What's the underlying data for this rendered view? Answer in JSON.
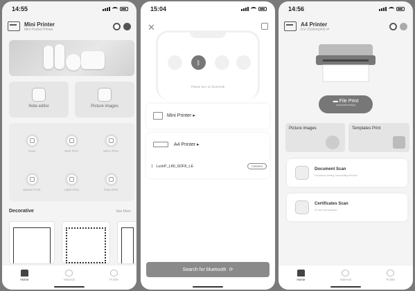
{
  "screen1": {
    "time": "14:55",
    "header": {
      "title": "Mini Printer",
      "subtitle": "Mini Pocket Printer"
    },
    "cards": [
      {
        "label": "Note editor",
        "icon": "note-editor-icon"
      },
      {
        "label": "Picture images",
        "icon": "picture-icon"
      }
    ],
    "grid": [
      {
        "label": "Scan",
        "icon": "scan-icon"
      },
      {
        "label": "Web Print",
        "icon": "web-print-icon"
      },
      {
        "label": "Micro Print",
        "icon": "micro-print-icon"
      },
      {
        "label": "Banner Print",
        "icon": "banner-print-icon"
      },
      {
        "label": "Label Print",
        "icon": "label-print-icon"
      },
      {
        "label": "Todo Print",
        "icon": "todo-print-icon"
      }
    ],
    "section_title": "Decorative",
    "see_more": "See More",
    "tabs": [
      {
        "label": "Home",
        "icon": "home-icon"
      },
      {
        "label": "Material",
        "icon": "material-icon"
      },
      {
        "label": "Profile",
        "icon": "profile-icon"
      }
    ]
  },
  "screen2": {
    "time": "15:04",
    "hint": "Please turn on bluetooth",
    "devices": [
      {
        "label": "Mini Printer ▸"
      },
      {
        "label": "A4 Printer ▸"
      }
    ],
    "bt_device": "LuckP_L80_6DF8_LE",
    "connect": "connect",
    "search": "Search for bluetooth"
  },
  "screen3": {
    "time": "14:56",
    "header": {
      "title": "A4 Printer",
      "subtitle": "8 in 210mm(A4) ⇄"
    },
    "file_print": "File Print",
    "file_print_sub": "word/pdf/excel/ppt",
    "cards": [
      {
        "label": "Picture images"
      },
      {
        "label": "Templates Print"
      }
    ],
    "scans": [
      {
        "title": "Document Scan",
        "sub": "Document printing, handwriting removal"
      },
      {
        "title": "Certificates Scan",
        "sub": "ID card and passport"
      }
    ],
    "tabs": [
      {
        "label": "Home"
      },
      {
        "label": "Material"
      },
      {
        "label": "Profile"
      }
    ]
  }
}
